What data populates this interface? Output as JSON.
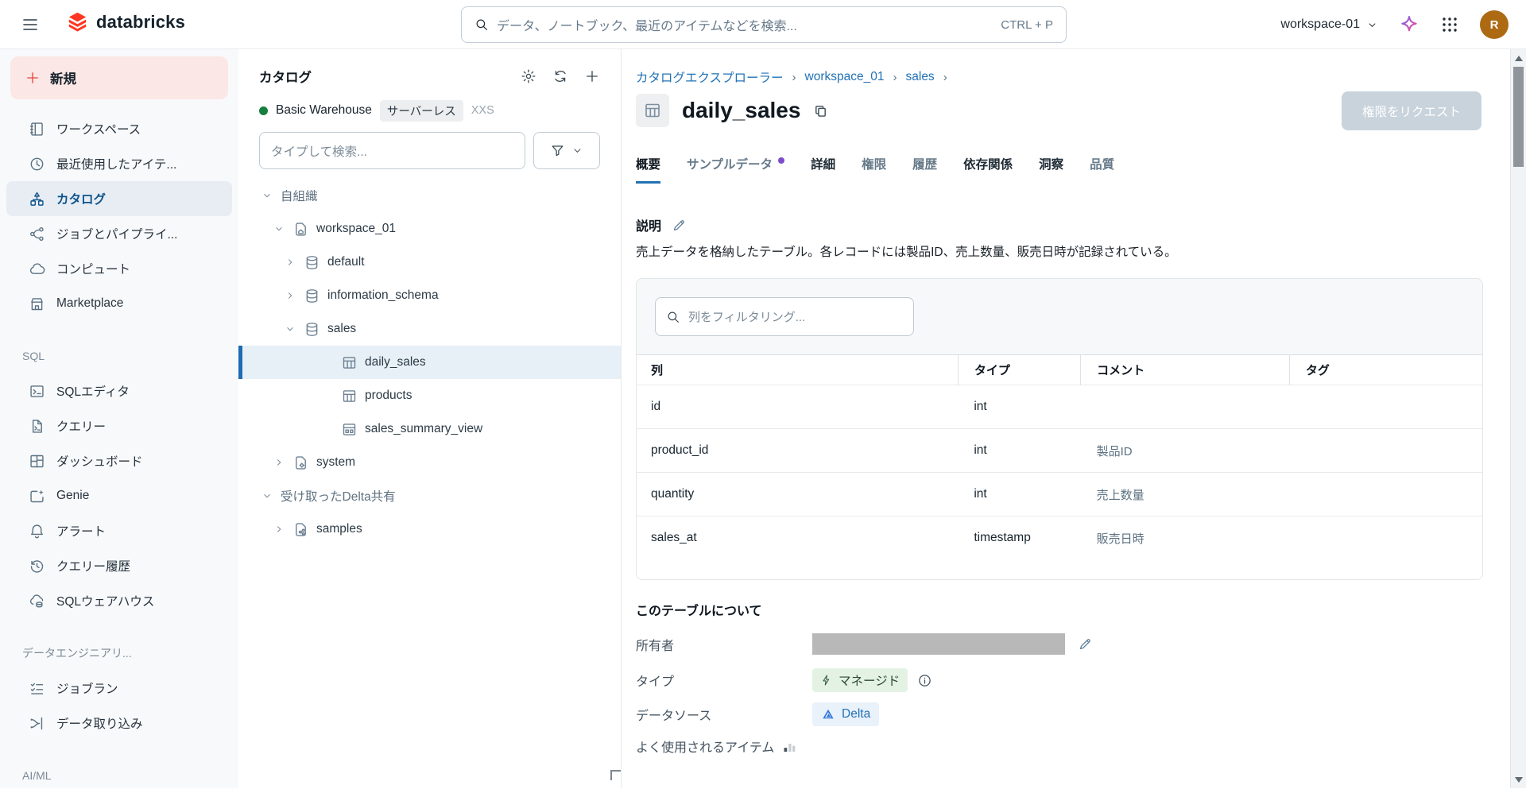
{
  "topbar": {
    "logo_text": "databricks",
    "search": {
      "placeholder": "データ、ノートブック、最近のアイテムなどを検索...",
      "shortcut": "CTRL + P"
    },
    "workspace_switcher": "workspace-01",
    "avatar_initial": "R",
    "icons": [
      "menu-icon",
      "search-icon",
      "assistant-sparkle-icon",
      "app-grid-icon"
    ]
  },
  "sidebar": {
    "new_button_label": "新規",
    "groups": [
      {
        "section": null,
        "items": [
          {
            "icon": "workspace",
            "label": "ワークスペース",
            "selected": false
          },
          {
            "icon": "clock",
            "label": "最近使用したアイテ...",
            "selected": false
          },
          {
            "icon": "catalog",
            "label": "カタログ",
            "selected": true
          },
          {
            "icon": "pipelines",
            "label": "ジョブとパイプライ...",
            "selected": false
          },
          {
            "icon": "cloud",
            "label": "コンピュート",
            "selected": false
          },
          {
            "icon": "store",
            "label": "Marketplace",
            "selected": false
          }
        ]
      },
      {
        "section": "SQL",
        "items": [
          {
            "icon": "sql-editor",
            "label": "SQLエディタ",
            "selected": false
          },
          {
            "icon": "query-file",
            "label": "クエリー",
            "selected": false
          },
          {
            "icon": "dashboard",
            "label": "ダッシュボード",
            "selected": false
          },
          {
            "icon": "genie",
            "label": "Genie",
            "selected": false
          },
          {
            "icon": "bell",
            "label": "アラート",
            "selected": false
          },
          {
            "icon": "history",
            "label": "クエリー履歴",
            "selected": false
          },
          {
            "icon": "warehouse",
            "label": "SQLウェアハウス",
            "selected": false
          }
        ]
      },
      {
        "section": "データエンジニアリ...",
        "items": [
          {
            "icon": "checklist",
            "label": "ジョブラン",
            "selected": false
          },
          {
            "icon": "ingest",
            "label": "データ取り込み",
            "selected": false
          }
        ]
      },
      {
        "section": "AI/ML",
        "items": []
      }
    ]
  },
  "catalog_panel": {
    "title": "カタログ",
    "header_icons": [
      "gear-icon",
      "refresh-icon",
      "plus-icon"
    ],
    "warehouse": {
      "status": "running",
      "name": "Basic Warehouse",
      "badge": "サーバーレス",
      "size": "XXS"
    },
    "search_placeholder": "タイプして検索...",
    "filter_button": "funnel-icon + chevron-down-icon",
    "tree": [
      {
        "label": "自組織",
        "level": 0,
        "caret": "down",
        "icon": null,
        "group": true,
        "selected": false
      },
      {
        "label": "workspace_01",
        "level": 1,
        "caret": "down",
        "icon": "catalog-home",
        "group": false,
        "selected": false
      },
      {
        "label": "default",
        "level": 2,
        "caret": "right",
        "icon": "schema",
        "group": false,
        "selected": false
      },
      {
        "label": "information_schema",
        "level": 2,
        "caret": "right",
        "icon": "schema",
        "group": false,
        "selected": false
      },
      {
        "label": "sales",
        "level": 2,
        "caret": "down",
        "icon": "schema",
        "group": false,
        "selected": false
      },
      {
        "label": "daily_sales",
        "level": 3,
        "caret": null,
        "icon": "table",
        "group": false,
        "selected": true
      },
      {
        "label": "products",
        "level": 3,
        "caret": null,
        "icon": "table",
        "group": false,
        "selected": false
      },
      {
        "label": "sales_summary_view",
        "level": 3,
        "caret": null,
        "icon": "view",
        "group": false,
        "selected": false
      },
      {
        "label": "system",
        "level": 1,
        "caret": "right",
        "icon": "catalog-system",
        "group": false,
        "selected": false
      },
      {
        "label": "受け取ったDelta共有",
        "level": 0,
        "caret": "down",
        "icon": null,
        "group": true,
        "selected": false
      },
      {
        "label": "samples",
        "level": 1,
        "caret": "right",
        "icon": "catalog-share",
        "group": false,
        "selected": false
      }
    ]
  },
  "main": {
    "breadcrumbs": [
      "カタログエクスプローラー",
      "workspace_01",
      "sales"
    ],
    "entity": {
      "type": "table",
      "title": "daily_sales"
    },
    "request_permission_label": "権限をリクエスト",
    "tabs": [
      {
        "label": "概要",
        "state": "active",
        "dot": false
      },
      {
        "label": "サンプルデータ",
        "state": "muted",
        "dot": true
      },
      {
        "label": "詳細",
        "state": "dark",
        "dot": false
      },
      {
        "label": "権限",
        "state": "muted",
        "dot": false
      },
      {
        "label": "履歴",
        "state": "muted",
        "dot": false
      },
      {
        "label": "依存関係",
        "state": "dark",
        "dot": false
      },
      {
        "label": "洞察",
        "state": "dark",
        "dot": false
      },
      {
        "label": "品質",
        "state": "muted",
        "dot": false
      }
    ],
    "description": {
      "label": "説明",
      "text": "売上データを格納したテーブル。各レコードには製品ID、売上数量、販売日時が記録されている。"
    },
    "columns_card": {
      "filter_placeholder": "列をフィルタリング...",
      "headers": [
        "列",
        "タイプ",
        "コメント",
        "タグ"
      ],
      "rows": [
        {
          "name": "id",
          "type": "int",
          "comment": "",
          "tags": ""
        },
        {
          "name": "product_id",
          "type": "int",
          "comment": "製品ID",
          "tags": ""
        },
        {
          "name": "quantity",
          "type": "int",
          "comment": "売上数量",
          "tags": ""
        },
        {
          "name": "sales_at",
          "type": "timestamp",
          "comment": "販売日時",
          "tags": ""
        }
      ]
    },
    "about": {
      "title": "このテーブルについて",
      "owner_label": "所有者",
      "owner_redacted": true,
      "type_label": "タイプ",
      "type_badge": "マネージド",
      "datasource_label": "データソース",
      "datasource_badge": "Delta",
      "popular_label": "よく使用されるアイテム"
    }
  },
  "colors": {
    "accent_blue": "#2272b4",
    "brand_red": "#ff3621",
    "selected_nav_text": "#0e538b",
    "managed_badge_bg": "#e4f2e4",
    "delta_badge_bg": "#e9f1fb",
    "warehouse_status_green": "#15803d",
    "sample_tab_dot_purple": "#7c4dcc",
    "avatar_bg": "#ad6a13"
  }
}
